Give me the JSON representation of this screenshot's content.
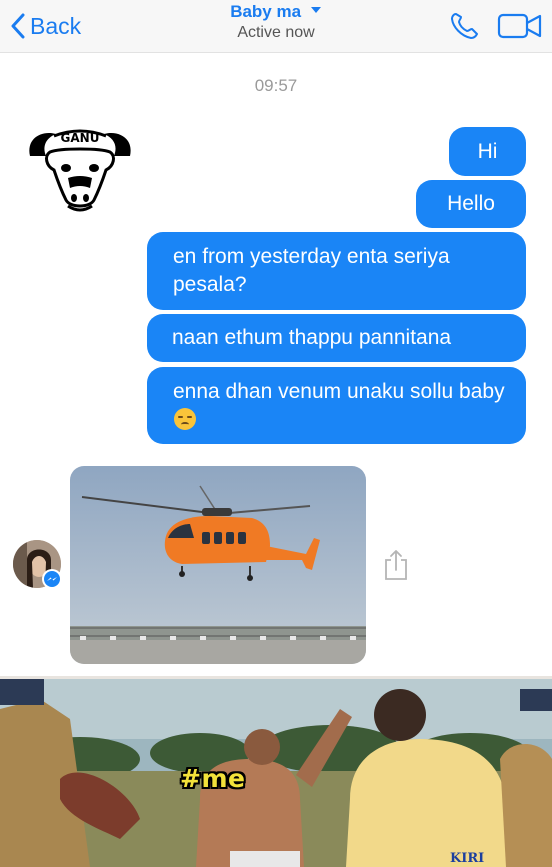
{
  "header": {
    "back_label": "Back",
    "contact_name": "Baby ma",
    "status": "Active now",
    "accent_color": "#1a7cf0",
    "icons": [
      "chevron-left-icon",
      "chevron-down-icon",
      "phone-icon",
      "video-camera-icon"
    ]
  },
  "conversation": {
    "timestamp": "09:57",
    "messages": [
      {
        "text": "Hi"
      },
      {
        "text": "Hello"
      },
      {
        "text": "en from yesterday enta seriya pesala?"
      },
      {
        "text": "naan ethum thappu pannitana"
      },
      {
        "text": "enna dhan venum unaku sollu baby",
        "emoji": "unamused-face-emoji"
      }
    ],
    "bubble_color": "#1a85f6",
    "received_image": "helicopter-photo",
    "share_icon": "share-icon"
  },
  "logo": {
    "text": "GANU"
  },
  "meme": {
    "caption": "#me",
    "watermark": "KIRI"
  }
}
